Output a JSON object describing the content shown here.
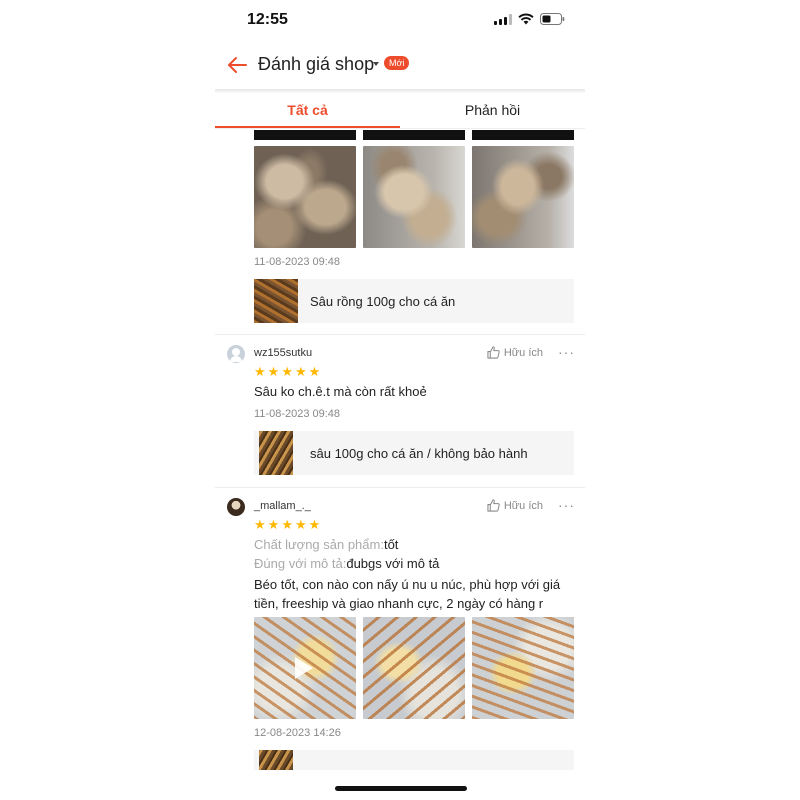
{
  "status_bar": {
    "time": "12:55"
  },
  "header": {
    "title": "Đánh giá shop",
    "badge": "Mới"
  },
  "tabs": [
    {
      "label": "Tất cả",
      "active": true
    },
    {
      "label": "Phản hồi",
      "active": false
    }
  ],
  "reviews": [
    {
      "date": "11-08-2023 09:48",
      "product": "Sâu rồng 100g cho cá ăn"
    },
    {
      "username": "wz155sutku",
      "helpful_label": "Hữu ích",
      "rating": 5,
      "text": "Sâu ko ch.ê.t mà còn rất khoẻ",
      "date": "11-08-2023 09:48",
      "product": "sâu 100g cho cá ăn / không bảo hành"
    },
    {
      "username": "_mallam_._",
      "helpful_label": "Hữu ích",
      "rating": 5,
      "attributes": [
        {
          "label": "Chất lượng sản phẩm:",
          "value": "tốt"
        },
        {
          "label": "Đúng với mô tả:",
          "value": "đubgs với mô tả"
        }
      ],
      "text": "Béo tốt, con nào con nấy ú nu u núc, phù hợp với giá tiền, freeship và giao nhanh cực, 2 ngày có hàng r",
      "date": "12-08-2023 14:26"
    }
  ],
  "colors": {
    "accent": "#ee4d2d",
    "star": "#ffb800"
  }
}
